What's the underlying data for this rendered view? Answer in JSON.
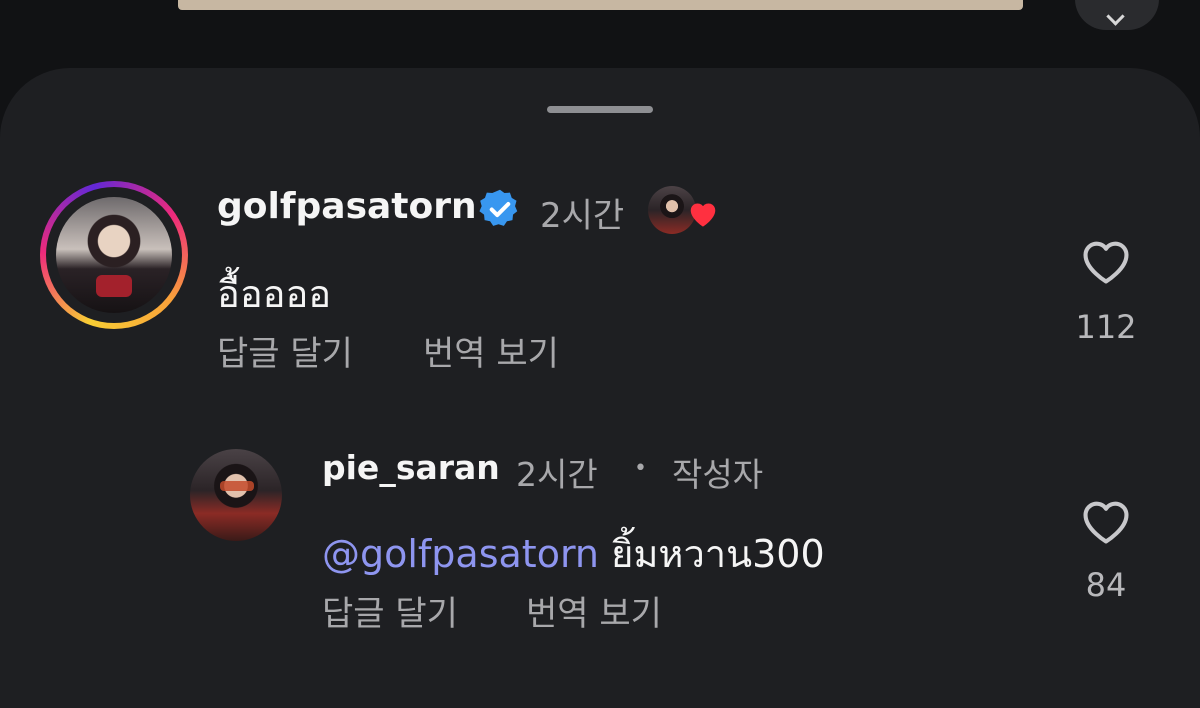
{
  "comments": [
    {
      "username": "golfpasatorn",
      "verified": true,
      "time": "2시간",
      "text": "อื้ออออ",
      "reply_label": "답글 달기",
      "translate_label": "번역 보기",
      "likes": "112",
      "has_creator_reaction": true
    }
  ],
  "replies": [
    {
      "username": "pie_saran",
      "time": "2시간",
      "separator": "•",
      "author_badge": "작성자",
      "mention": "@golfpasatorn",
      "text": "ยิ้มหวาน300",
      "reply_label": "답글 달기",
      "translate_label": "번역 보기",
      "likes": "84"
    }
  ],
  "colors": {
    "background": "#111214",
    "sheet": "#1e1f22",
    "mention": "#8e95f0",
    "verified": "#3897f0",
    "heart": "#ff3040"
  },
  "icons": [
    "verified-badge-icon",
    "heart-outline-icon",
    "reaction-heart-icon",
    "chevron-down-icon"
  ]
}
